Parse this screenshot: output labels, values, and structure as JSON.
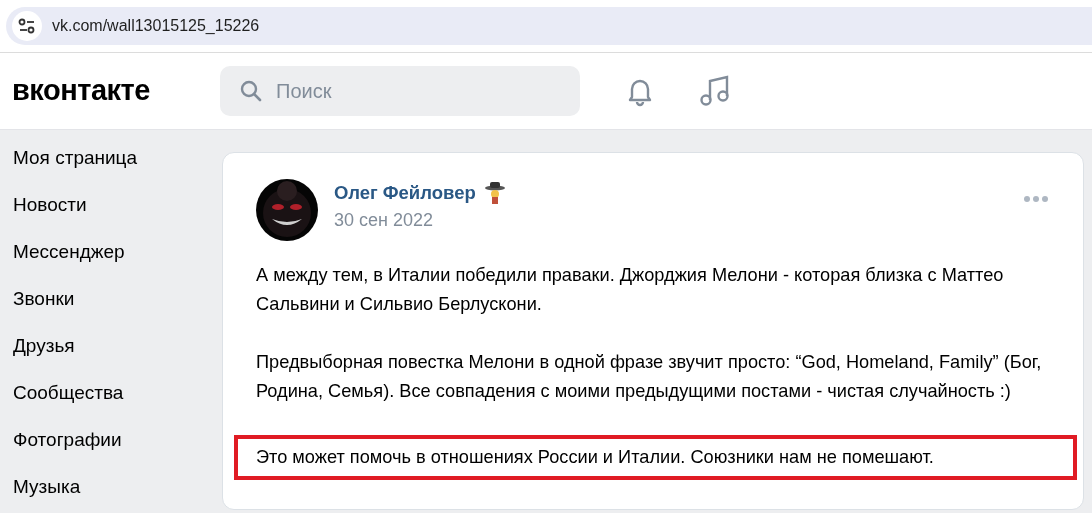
{
  "address_bar": {
    "url": "vk.com/wall13015125_15226"
  },
  "header": {
    "logo": "вконтакте",
    "search": {
      "placeholder": "Поиск"
    }
  },
  "sidebar": {
    "items": [
      {
        "label": "Моя страница"
      },
      {
        "label": "Новости"
      },
      {
        "label": "Мессенджер"
      },
      {
        "label": "Звонки"
      },
      {
        "label": "Друзья"
      },
      {
        "label": "Сообщества"
      },
      {
        "label": "Фотографии"
      },
      {
        "label": "Музыка"
      }
    ]
  },
  "post": {
    "author": "Олег Фейловер",
    "date": "30 сен 2022",
    "paragraphs": [
      {
        "text": "А между тем, в Италии победили праваки. Джорджия Мелони - которая близка с Маттео Сальвини и Сильвио Берлускони.",
        "highlighted": false
      },
      {
        "text": "Предвыборная повестка Мелони в одной фразе звучит просто: “God, Homeland, Family” (Бог, Родина, Семья). Все совпадения с моими предыдущими постами - чистая случайность :)",
        "highlighted": false
      },
      {
        "text": "Это может помочь в отношениях России и Италии. Союзники нам не помешают.",
        "highlighted": true
      }
    ]
  }
}
